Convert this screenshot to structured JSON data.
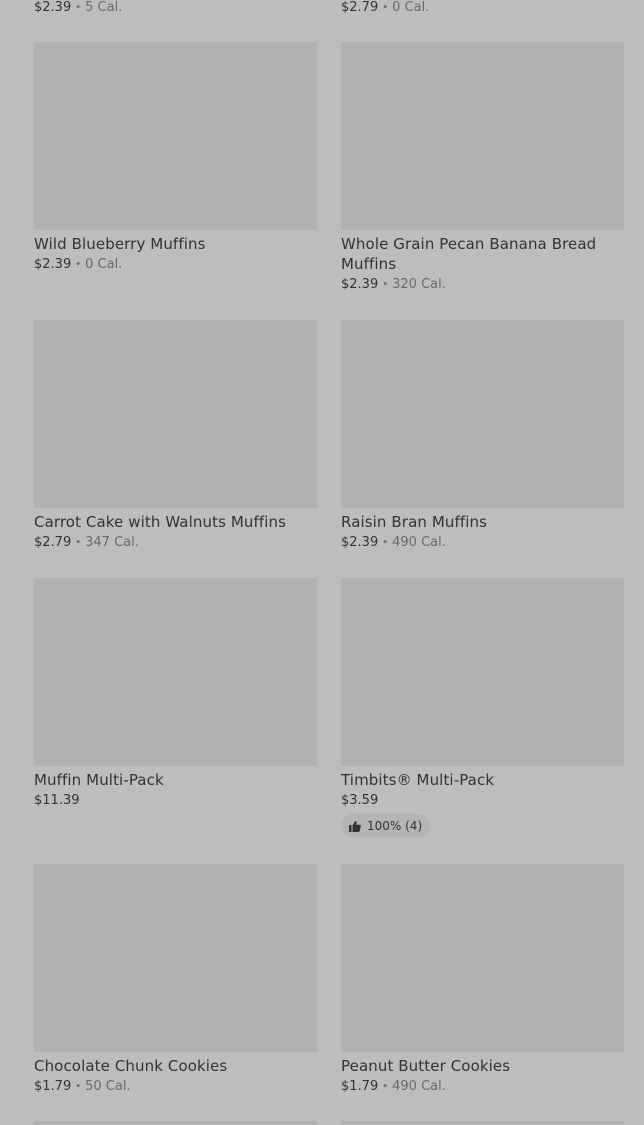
{
  "top_row": [
    {
      "price": "$2.39",
      "calories": "5 Cal."
    },
    {
      "price": "$2.79",
      "calories": "0 Cal."
    }
  ],
  "items": [
    {
      "name": "Wild Blueberry Muffins",
      "price": "$2.39",
      "calories": "0 Cal."
    },
    {
      "name": "Whole Grain Pecan Banana Bread Muffins",
      "price": "$2.39",
      "calories": "320 Cal."
    },
    {
      "name": "Carrot Cake with Walnuts Muffins",
      "price": "$2.79",
      "calories": "347 Cal."
    },
    {
      "name": "Raisin Bran Muffins",
      "price": "$2.39",
      "calories": "490 Cal."
    },
    {
      "name": "Muffin Multi-Pack",
      "price": "$11.39"
    },
    {
      "name": "Timbits® Multi-Pack",
      "price": "$3.59",
      "rating": "100% (4)"
    },
    {
      "name": "Chocolate Chunk Cookies",
      "price": "$1.79",
      "calories": "50 Cal."
    },
    {
      "name": "Peanut Butter Cookies",
      "price": "$1.79",
      "calories": "490 Cal."
    }
  ],
  "separator": "•",
  "icons": {
    "rating": "thumbs-up-icon"
  },
  "colors": {
    "background": "#bdbdbd",
    "image_placeholder": "#b1b1b1",
    "text": "#333333",
    "muted_text": "#6a6a6a"
  }
}
